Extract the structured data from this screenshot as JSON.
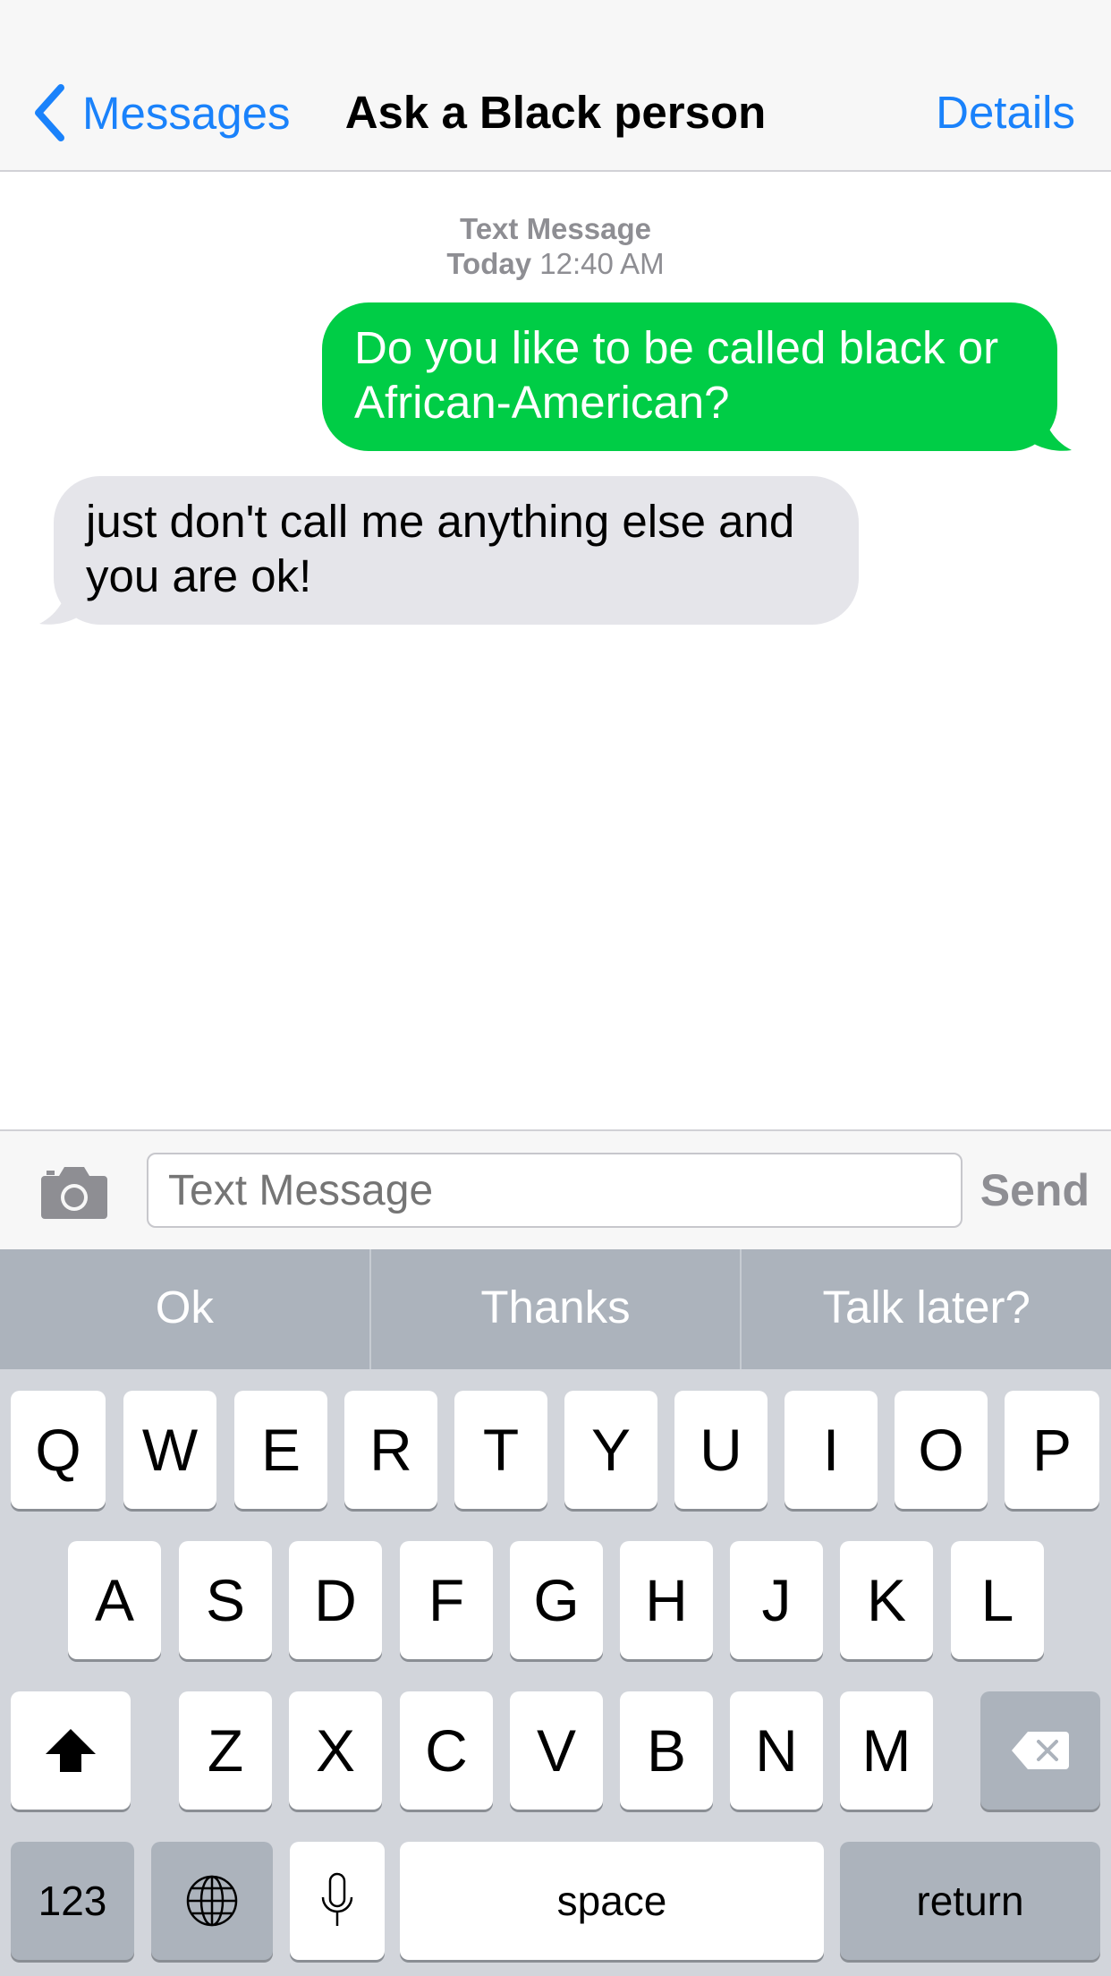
{
  "nav": {
    "back_label": "Messages",
    "title": "Ask a Black person",
    "details_label": "Details"
  },
  "conversation": {
    "header": "Text Message",
    "day": "Today",
    "time": "12:40 AM",
    "messages": [
      {
        "direction": "outgoing",
        "text": "Do you like to be called black or African-American?"
      },
      {
        "direction": "incoming",
        "text": "just don't call me anything else and you are ok!"
      }
    ]
  },
  "input": {
    "placeholder": "Text Message",
    "send_label": "Send"
  },
  "predictive": [
    "Ok",
    "Thanks",
    "Talk later?"
  ],
  "keyboard": {
    "row1": [
      "Q",
      "W",
      "E",
      "R",
      "T",
      "Y",
      "U",
      "I",
      "O",
      "P"
    ],
    "row2": [
      "A",
      "S",
      "D",
      "F",
      "G",
      "H",
      "J",
      "K",
      "L"
    ],
    "row3": [
      "Z",
      "X",
      "C",
      "V",
      "B",
      "N",
      "M"
    ],
    "numbers_label": "123",
    "space_label": "space",
    "return_label": "return"
  },
  "icons": {
    "back": "chevron-left-icon",
    "camera": "camera-icon",
    "shift": "shift-arrow-icon",
    "delete": "backspace-icon",
    "globe": "globe-icon",
    "mic": "microphone-icon"
  },
  "colors": {
    "accent": "#1a82fb",
    "outgoing_bubble": "#00cd46",
    "incoming_bubble": "#e5e5ea",
    "keyboard_bg": "#d2d5db",
    "dark_key": "#acb3bc"
  }
}
